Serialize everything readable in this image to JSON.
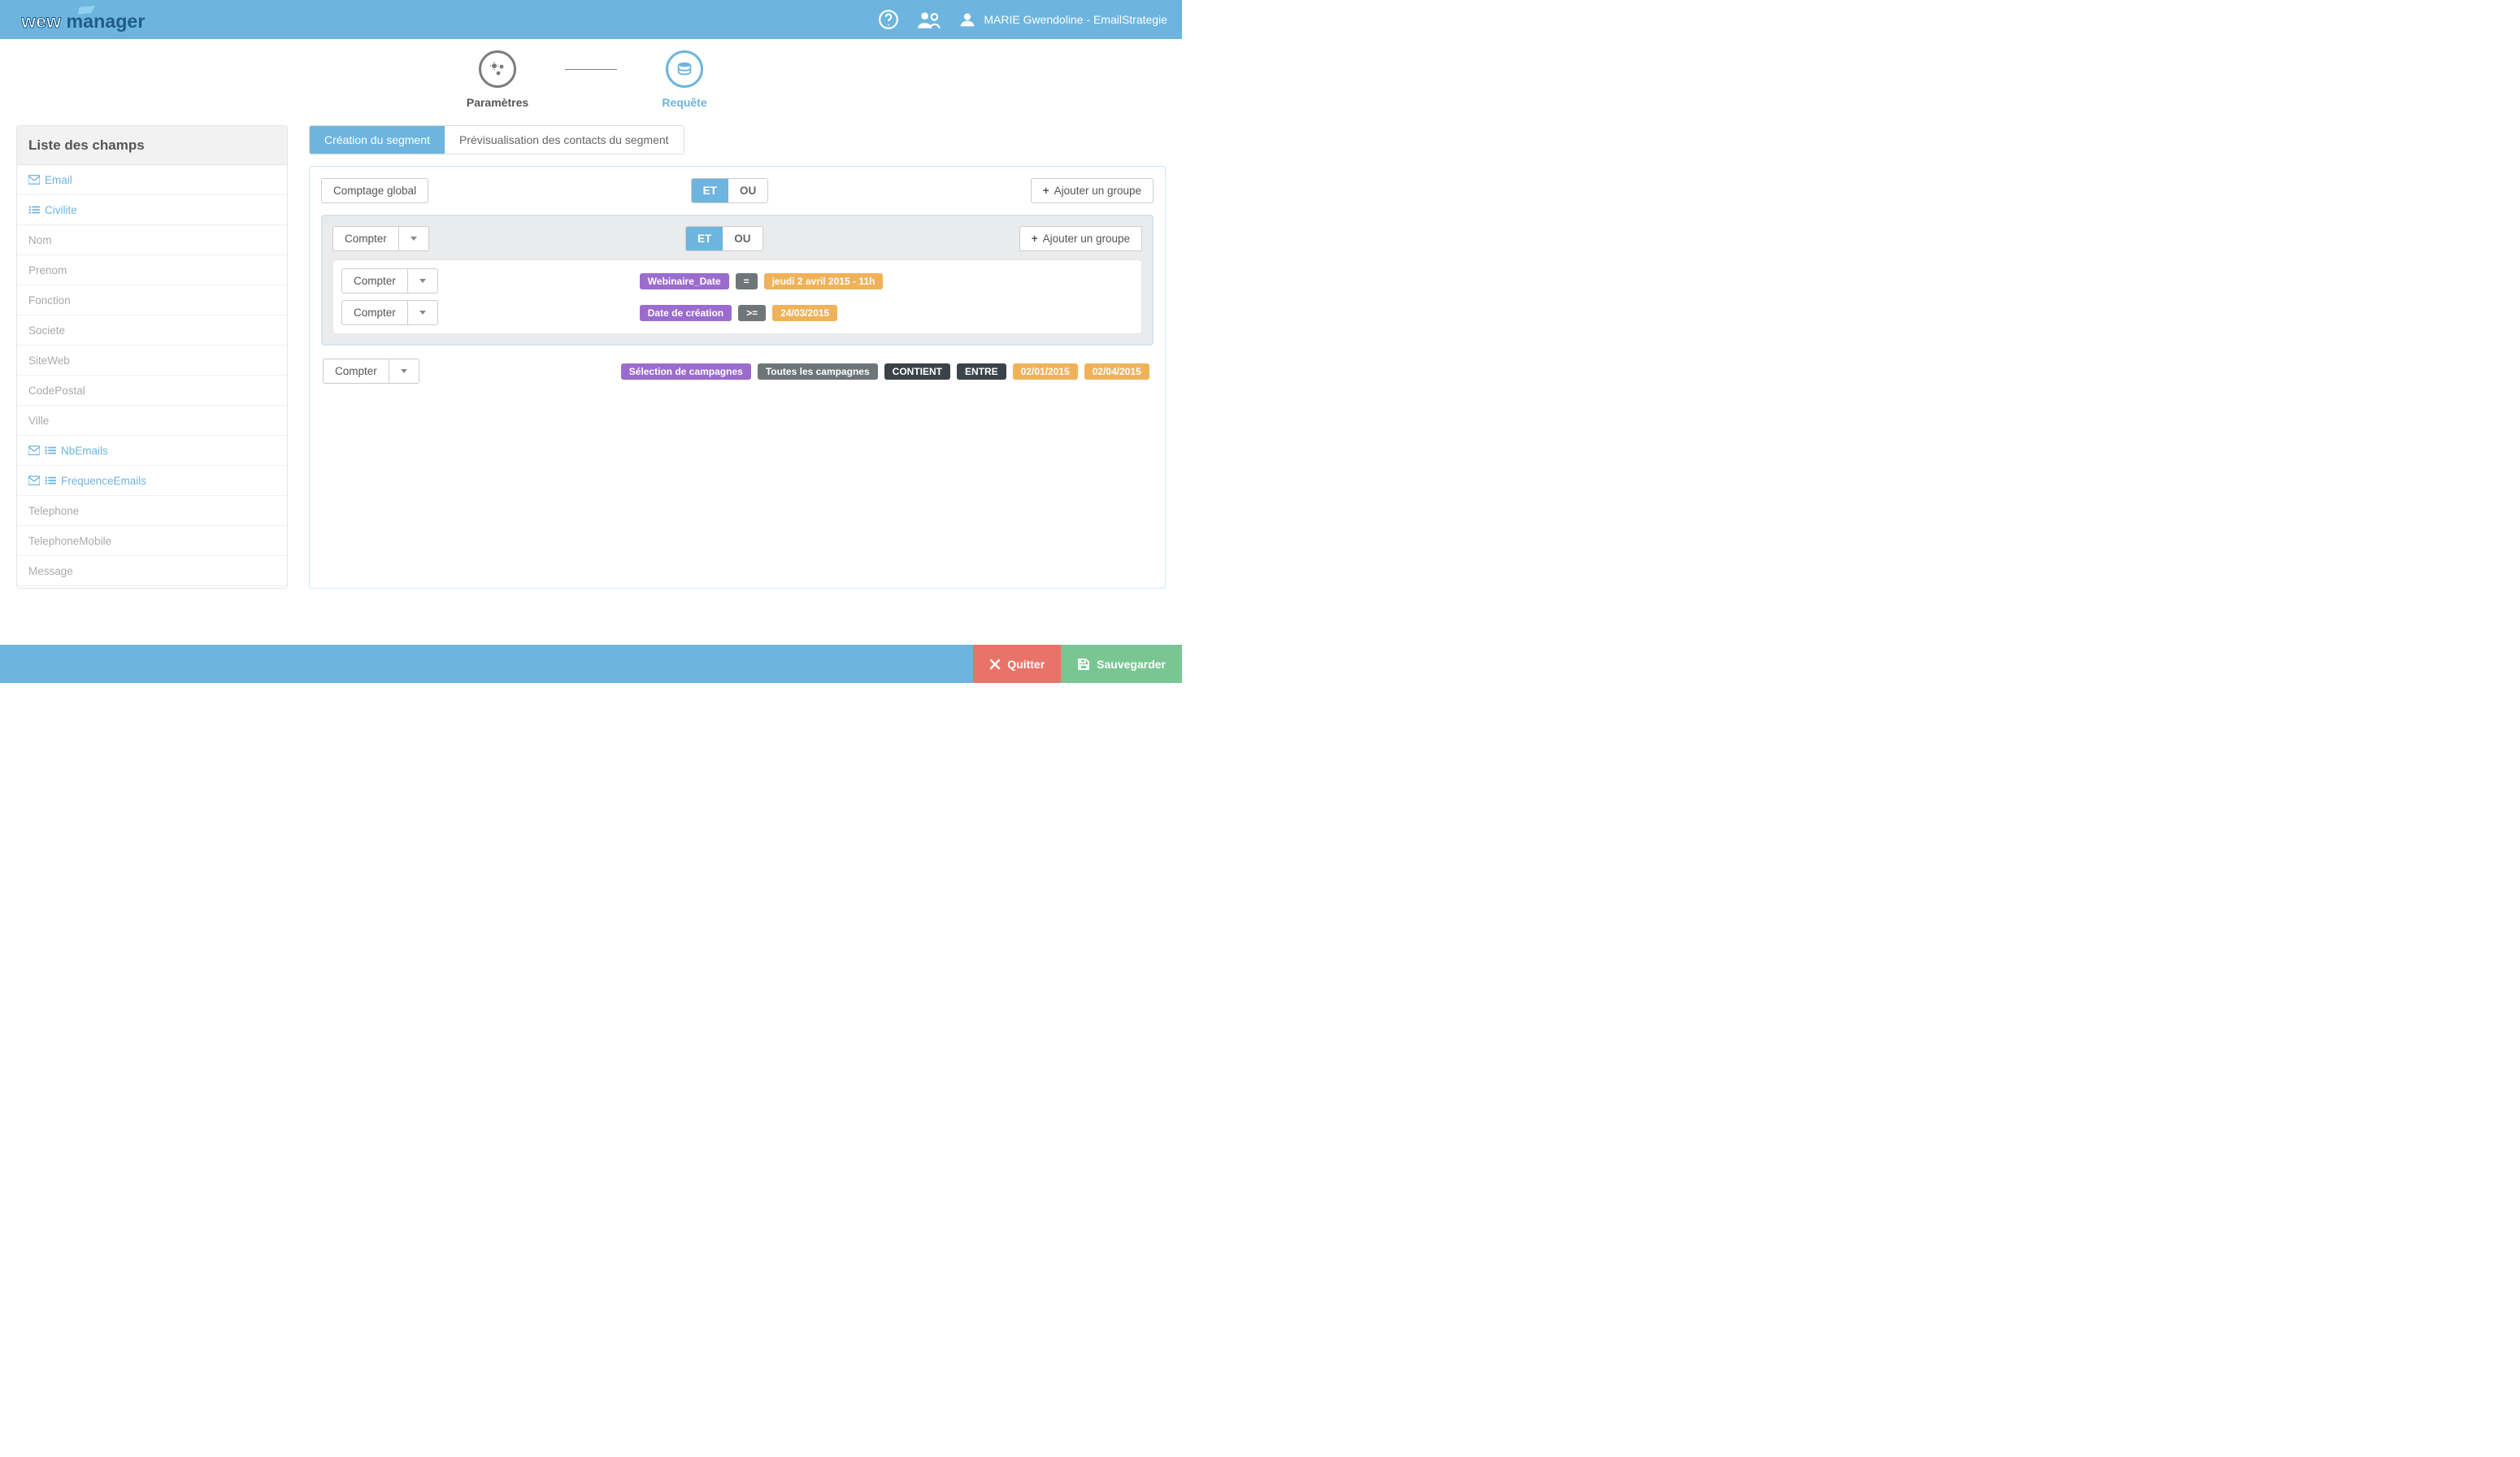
{
  "header": {
    "user_label": "MARIE Gwendoline - EmailStrategie"
  },
  "steps": {
    "param": "Paramètres",
    "query": "Requête"
  },
  "sidebar": {
    "title": "Liste des champs",
    "items": [
      {
        "label": "Email",
        "icons": [
          "mail"
        ]
      },
      {
        "label": "Civilite",
        "icons": [
          "list"
        ]
      },
      {
        "label": "Nom",
        "icons": []
      },
      {
        "label": "Prenom",
        "icons": []
      },
      {
        "label": "Fonction",
        "icons": []
      },
      {
        "label": "Societe",
        "icons": []
      },
      {
        "label": "SiteWeb",
        "icons": []
      },
      {
        "label": "CodePostal",
        "icons": []
      },
      {
        "label": "Ville",
        "icons": []
      },
      {
        "label": "NbEmails",
        "icons": [
          "mail",
          "list"
        ]
      },
      {
        "label": "FrequenceEmails",
        "icons": [
          "mail",
          "list"
        ]
      },
      {
        "label": "Telephone",
        "icons": []
      },
      {
        "label": "TelephoneMobile",
        "icons": []
      },
      {
        "label": "Message",
        "icons": []
      }
    ]
  },
  "tabs": {
    "create": "Création du segment",
    "preview": "Prévisualisation des contacts du segment"
  },
  "builder": {
    "global_count": "Comptage global",
    "count": "Compter",
    "et": "ET",
    "ou": "OU",
    "add_group": "Ajouter un groupe"
  },
  "rules": {
    "r1": {
      "field": "Webinaire_Date",
      "op": "=",
      "value": "jeudi 2 avril 2015 - 11h"
    },
    "r2": {
      "field": "Date de création",
      "op": ">=",
      "value": "24/03/2015"
    },
    "r3": {
      "field": "Sélection de campagnes",
      "campaigns": "Toutes les campagnes",
      "contains": "CONTIENT",
      "between": "ENTRE",
      "from": "02/01/2015",
      "to": "02/04/2015"
    }
  },
  "footer": {
    "quit": "Quitter",
    "save": "Sauvegarder"
  }
}
